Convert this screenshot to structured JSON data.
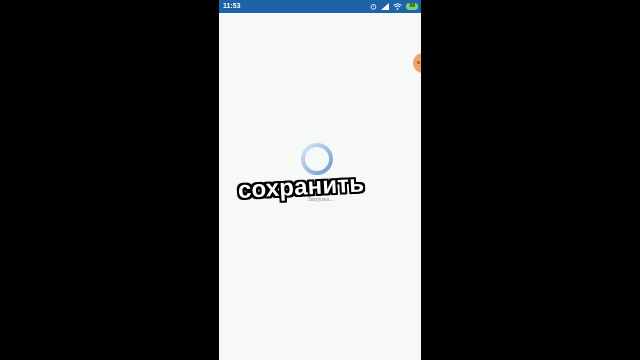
{
  "status_bar": {
    "time": "11:53",
    "icons": [
      "alarm-icon",
      "signal-icon",
      "wifi-icon"
    ],
    "battery": "98",
    "background_color": "#1e63a8"
  },
  "screen": {
    "background_color": "#f6f9f6",
    "loading_text": "Загрузка...",
    "spinner_color": "#a9c6e6"
  },
  "side_tab": {
    "color": "#f0a36e"
  },
  "overlay": {
    "caption": "сохранить"
  }
}
